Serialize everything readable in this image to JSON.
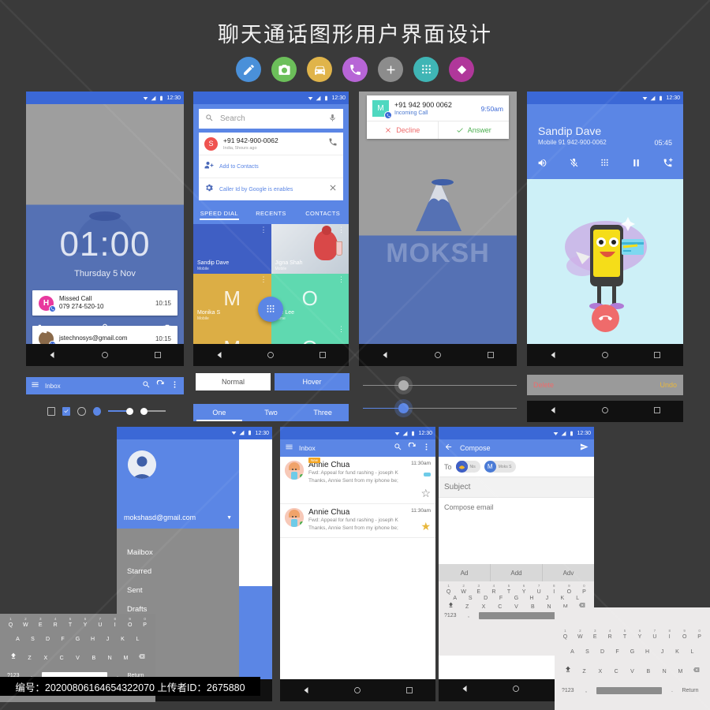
{
  "header": {
    "title": "聊天通话图形用户界面设计",
    "icons": [
      {
        "name": "pencil-icon",
        "color": "#4a90d9"
      },
      {
        "name": "camera-icon",
        "color": "#6cbf5a"
      },
      {
        "name": "car-icon",
        "color": "#e0b44a"
      },
      {
        "name": "phone-icon",
        "color": "#b765d6"
      },
      {
        "name": "plus-icon",
        "color": "#8c8c8c"
      },
      {
        "name": "dialpad-icon",
        "color": "#3fb5b5"
      },
      {
        "name": "diamond-icon",
        "color": "#b0379a"
      }
    ]
  },
  "status_bar": {
    "time": "12:30"
  },
  "lockscreen": {
    "time": "01:00",
    "date": "Thursday 5 Nov",
    "notifications": [
      {
        "avatar_letter": "H",
        "avatar_color": "#e8399e",
        "badge": "phone-icon",
        "line1": "Missed Call",
        "line2": "079 274-520-10",
        "time": "10:15"
      },
      {
        "avatar_letter": "",
        "avatar_color": "#8a6a4a",
        "badge": "mail-icon",
        "line1": "jstechnosys@gmail.com",
        "line2": "",
        "time": "10:15"
      }
    ],
    "actions": [
      "phone-icon",
      "lock-icon",
      "camera-icon"
    ]
  },
  "dialer": {
    "search_placeholder": "Search",
    "caller": {
      "avatar_letter": "S",
      "number": "+91 942-900-0062",
      "subtitle": "India, 5hours ago"
    },
    "add_to_contacts": "Add to Contacts",
    "caller_id_note": "Caller Id by Google is enables",
    "tabs": [
      {
        "label": "SPEED DIAL",
        "active": true
      },
      {
        "label": "RECENTS",
        "active": false
      },
      {
        "label": "CONTACTS",
        "active": false
      }
    ],
    "tiles": [
      {
        "name": "Sandip Dave",
        "sub": "Mobile",
        "color": "#3f5fc4",
        "letter": ""
      },
      {
        "name": "Jigna Shah",
        "sub": "Mobile",
        "color": "#c9cfd6",
        "letter": ""
      },
      {
        "name": "Monika S",
        "sub": "Mobile",
        "color": "#dcae45",
        "letter": "M"
      },
      {
        "name": "Ole Lee",
        "sub": "Home",
        "color": "#5fd9b0",
        "letter": "O"
      },
      {
        "name": "",
        "sub": "",
        "color": "#dcae45",
        "letter": "M"
      },
      {
        "name": "",
        "sub": "",
        "color": "#5fd9b0",
        "letter": "O"
      }
    ],
    "fab": "dialpad-icon"
  },
  "incoming_call": {
    "avatar_letter": "M",
    "number": "+91 942 900 0062",
    "state": "Incoming Call",
    "time": "9:50am",
    "decline_label": "Decline",
    "answer_label": "Answer",
    "wallpaper_text": "MOKSH"
  },
  "in_call": {
    "name": "Sandip Dave",
    "sub": "Mobile 91 942-900-0062",
    "duration": "05:45",
    "controls": [
      "speaker-icon",
      "mute-icon",
      "dialpad-icon",
      "hold-icon",
      "add-call-icon"
    ],
    "end_call": "end-call-icon"
  },
  "components": {
    "appbar_title": "Inbox",
    "appbar_icons": [
      "menu-icon",
      "search-icon",
      "refresh-icon",
      "overflow-icon"
    ],
    "buttons": {
      "normal": "Normal",
      "hover": "Hover"
    },
    "tabs": [
      {
        "label": "One",
        "active": true
      },
      {
        "label": "Two",
        "active": false
      },
      {
        "label": "Three",
        "active": false
      }
    ],
    "snackbar": {
      "action_left": "Delete",
      "action_right": "Undo"
    }
  },
  "drawer": {
    "email": "mokshasd@gmail.com",
    "items": [
      "Mailbox",
      "Starred",
      "Sent",
      "Drafts"
    ]
  },
  "inbox": {
    "title": "Inbox",
    "messages": [
      {
        "from": "Annie Chua",
        "time": "11:30am",
        "snippet_line1": "Fwd: Appeal for fund rashing - joseph K",
        "snippet_line2": "Thanks, Annie Sent from my iphone be;",
        "badge": "New",
        "starred": false
      },
      {
        "from": "Annie Chua",
        "time": "11:30am",
        "snippet_line1": "Fwd: Appeal for fund rashing - joseph K",
        "snippet_line2": "Thanks, Annie Sent from my iphone be;",
        "badge": "",
        "starred": true
      }
    ]
  },
  "compose": {
    "title": "Compose",
    "to_label": "To",
    "chips": [
      {
        "initial": "",
        "name": "Nis",
        "color": "#3f5fc4"
      },
      {
        "initial": "M",
        "name": "Moks S",
        "color": "#4a7bd6"
      }
    ],
    "subject_placeholder": "Subject",
    "body_placeholder": "Compose email",
    "suggestions": [
      "Ad",
      "Add",
      "Adv"
    ]
  },
  "keyboard": {
    "numbers": [
      "1",
      "2",
      "3",
      "4",
      "5",
      "6",
      "7",
      "8",
      "9",
      "0"
    ],
    "row1": [
      "Q",
      "W",
      "E",
      "R",
      "T",
      "Y",
      "U",
      "I",
      "O",
      "P"
    ],
    "row2": [
      "A",
      "S",
      "D",
      "F",
      "G",
      "H",
      "J",
      "K",
      "L"
    ],
    "row3": [
      "Z",
      "X",
      "C",
      "V",
      "B",
      "N",
      "M"
    ],
    "shift": "shift-icon",
    "backspace": "backspace-icon",
    "sym": "?123",
    "comma": ",",
    "period": ".",
    "return": "Return"
  },
  "caption": "编号：20200806164654322070 上传者ID：2675880",
  "colors": {
    "background": "#3a3a3a",
    "primary_blue": "#5b86e5",
    "status_blue": "#3b68d6",
    "accent_red": "#ef6b6b",
    "accent_green": "#4caf50",
    "accent_amber": "#e8b73c"
  }
}
